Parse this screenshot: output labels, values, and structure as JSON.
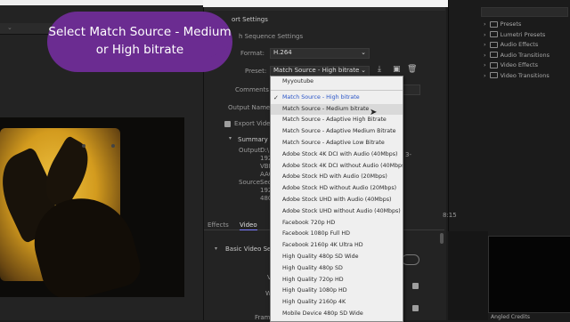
{
  "callout": {
    "text": "Select Match Source - Medium or High bitrate"
  },
  "dialog": {
    "section_title": "ort Settings",
    "match_sequence": "h Sequence Settings",
    "format_label": "Format:",
    "format_value": "H.264",
    "preset_label": "Preset:",
    "preset_value": "Match Source - High bitrate",
    "comments_label": "Comments",
    "output_name_label": "Output Name:",
    "export_video_label": "Export Video",
    "summary_label": "Summary",
    "output_label": "Output:",
    "output_values": [
      "D:\\",
      "192",
      "VBF",
      "AAC"
    ],
    "source_label": "Source:",
    "source_values": [
      "Seq",
      "192",
      "480"
    ],
    "right_trunc": "3-",
    "tabs": [
      "Effects",
      "Video"
    ],
    "basic_video_settings": "Basic Video Setti",
    "row_labels": [
      "V",
      "W"
    ],
    "frame_label": "Frame"
  },
  "dropdown": {
    "items": [
      {
        "label": "Myyoutube",
        "selected": false,
        "hover": false
      },
      {
        "label": "Match Source - High bitrate",
        "selected": true,
        "hover": false
      },
      {
        "label": "Match Source - Medium bitrate",
        "selected": false,
        "hover": true
      },
      {
        "label": "Match Source - Adaptive High Bitrate",
        "selected": false,
        "hover": false
      },
      {
        "label": "Match Source - Adaptive Medium Bitrate",
        "selected": false,
        "hover": false
      },
      {
        "label": "Match Source - Adaptive Low Bitrate",
        "selected": false,
        "hover": false
      },
      {
        "label": "Adobe Stock 4K DCI with Audio (40Mbps)",
        "selected": false,
        "hover": false
      },
      {
        "label": "Adobe Stock 4K DCI without Audio (40Mbps)",
        "selected": false,
        "hover": false
      },
      {
        "label": "Adobe Stock HD with Audio (20Mbps)",
        "selected": false,
        "hover": false
      },
      {
        "label": "Adobe Stock HD without Audio (20Mbps)",
        "selected": false,
        "hover": false
      },
      {
        "label": "Adobe Stock UHD with Audio (40Mbps)",
        "selected": false,
        "hover": false
      },
      {
        "label": "Adobe Stock UHD without Audio (40Mbps)",
        "selected": false,
        "hover": false
      },
      {
        "label": "Facebook 720p HD",
        "selected": false,
        "hover": false
      },
      {
        "label": "Facebook 1080p Full HD",
        "selected": false,
        "hover": false
      },
      {
        "label": "Facebook 2160p 4K Ultra HD",
        "selected": false,
        "hover": false
      },
      {
        "label": "High Quality 480p SD Wide",
        "selected": false,
        "hover": false
      },
      {
        "label": "High Quality 480p SD",
        "selected": false,
        "hover": false
      },
      {
        "label": "High Quality 720p HD",
        "selected": false,
        "hover": false
      },
      {
        "label": "High Quality 1080p HD",
        "selected": false,
        "hover": false
      },
      {
        "label": "High Quality 2160p 4K",
        "selected": false,
        "hover": false
      },
      {
        "label": "Mobile Device 480p SD Wide",
        "selected": false,
        "hover": false
      }
    ]
  },
  "effects_panel": {
    "items": [
      "Presets",
      "Lumetri Presets",
      "Audio Effects",
      "Audio Transitions",
      "Video Effects",
      "Video Transitions"
    ]
  },
  "timecode": "8:15",
  "program_label": "Angled Credits",
  "colors": {
    "callout": "#6b2c91",
    "selected_item": "#2a55c8",
    "accent": "#7e7eff"
  },
  "icons": [
    "search-icon",
    "save-preset-icon",
    "import-preset-icon",
    "delete-preset-icon",
    "chevron-down-icon",
    "check-icon",
    "folder-icon",
    "cursor-icon",
    "plus-icon"
  ]
}
